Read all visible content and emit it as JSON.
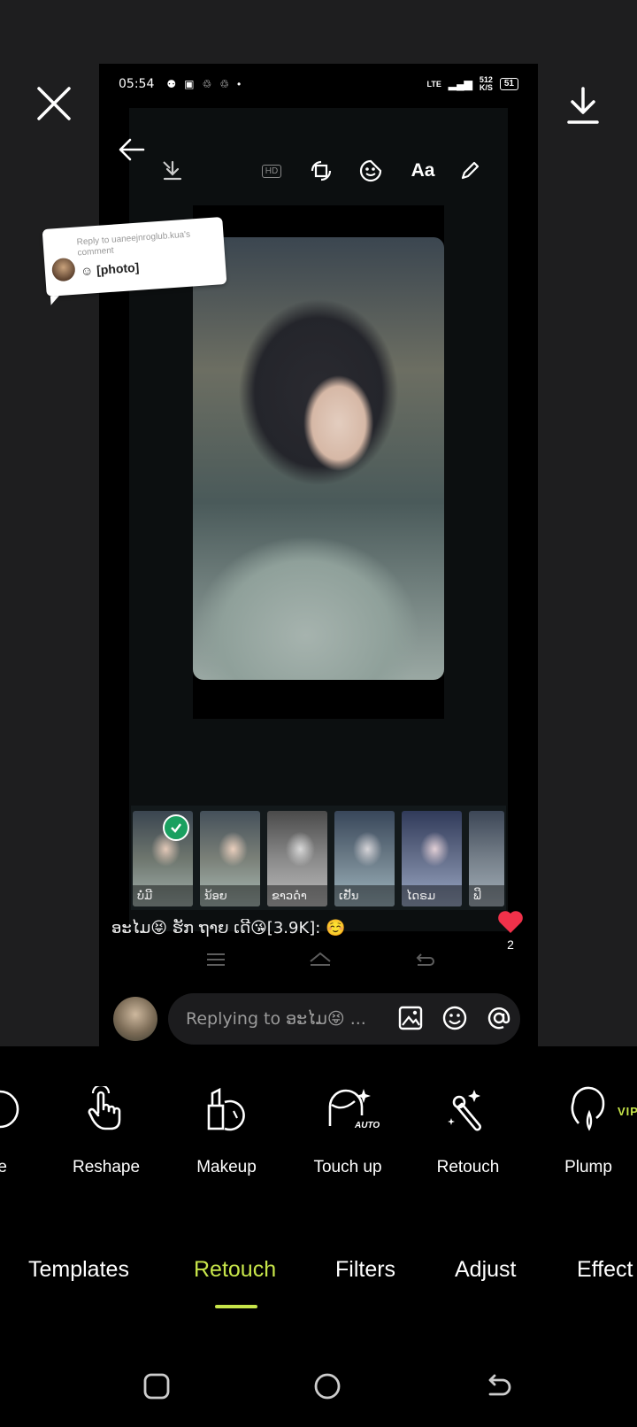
{
  "editor": {
    "close_icon": "close-icon",
    "download_icon": "download-icon"
  },
  "inner_status": {
    "time": "05:54",
    "network": "LTE",
    "speed_top": "512",
    "speed_bottom": "K/S",
    "battery": "51"
  },
  "story_tools": [
    "save-icon",
    "hd-icon",
    "crop-rotate-icon",
    "sticker-icon",
    "text-icon",
    "draw-icon"
  ],
  "hd_label": "HD",
  "text_tool_label": "Aa",
  "sticker": {
    "reply_to": "Reply to uaneejnroglub.kua's comment",
    "content": "☺ [photo]"
  },
  "filters": [
    {
      "label": "ບໍ່ມີ",
      "selected": true
    },
    {
      "label": "ນ້ອຍ",
      "selected": false
    },
    {
      "label": "ຂາວດຳ",
      "selected": false
    },
    {
      "label": "ເຢັນ",
      "selected": false
    },
    {
      "label": "ໄດຣມ",
      "selected": false
    },
    {
      "label": "ຟິ",
      "selected": false
    }
  ],
  "comment": {
    "text": "ອະໄມ😝 ຮັກ ຖາຍ ເດີ😘[3.9K]: ☺️",
    "likes": "2"
  },
  "reply": {
    "placeholder": "Replying to ອະໄມ😝 ..."
  },
  "tools": [
    {
      "label": "e",
      "icon": "face-icon"
    },
    {
      "label": "Reshape",
      "icon": "hand-touch-icon"
    },
    {
      "label": "Makeup",
      "icon": "makeup-icon"
    },
    {
      "label": "Touch up",
      "icon": "auto-face-icon"
    },
    {
      "label": "Retouch",
      "icon": "wand-icon"
    },
    {
      "label": "Plump",
      "icon": "plump-icon"
    }
  ],
  "auto_badge": "AUTO",
  "vip_badge": "VIP",
  "tabs": [
    {
      "label": "Templates",
      "active": false
    },
    {
      "label": "Retouch",
      "active": true
    },
    {
      "label": "Filters",
      "active": false
    },
    {
      "label": "Adjust",
      "active": false
    },
    {
      "label": "Effect",
      "active": false
    }
  ],
  "colors": {
    "accent": "#c7e54a",
    "panel_bg": "#000000",
    "like_red": "#f0314a",
    "check_green": "#1aa060"
  }
}
